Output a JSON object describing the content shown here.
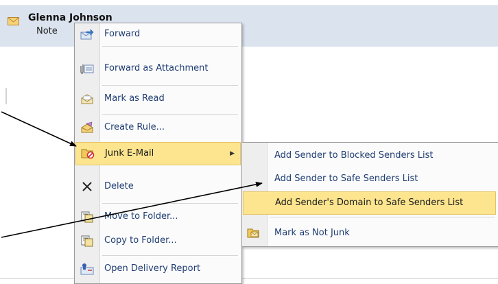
{
  "mail": {
    "sender": "Glenna Johnson",
    "subject": "Note"
  },
  "context_menu": {
    "items": [
      {
        "label": "Forward",
        "icon": "forward-icon"
      },
      {
        "label": "Forward as Attachment",
        "icon": "attachment-icon"
      },
      {
        "label": "Mark as Read",
        "icon": "envelope-open-icon"
      },
      {
        "label": "Create Rule...",
        "icon": "rule-icon"
      },
      {
        "label": "Junk E-Mail",
        "icon": "junk-icon",
        "highlighted": true,
        "has_submenu": true
      },
      {
        "label": "Delete",
        "icon": "delete-icon"
      },
      {
        "label": "Move to Folder...",
        "icon": "move-folder-icon"
      },
      {
        "label": "Copy to Folder...",
        "icon": "copy-folder-icon"
      },
      {
        "label": "Open Delivery Report",
        "icon": "delivery-report-icon"
      }
    ]
  },
  "junk_submenu": {
    "items": [
      {
        "label": "Add Sender to Blocked Senders List"
      },
      {
        "label": "Add Sender to Safe Senders List"
      },
      {
        "label": "Add Sender's Domain to Safe Senders List",
        "highlighted": true
      },
      {
        "label": "Mark as Not Junk",
        "icon": "not-junk-icon"
      }
    ]
  },
  "colors": {
    "highlight": "#fde58f",
    "menu_text": "#1f3d73",
    "row_bg": "#dbe3ee"
  }
}
